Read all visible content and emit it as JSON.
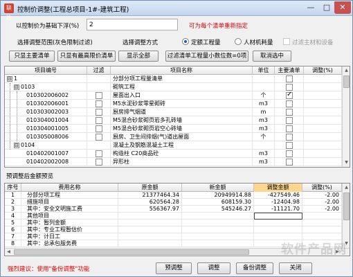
{
  "window": {
    "title": "控制价调整(工程总项目-1#-建筑工程)",
    "app_icon": "联达",
    "minimize_glyph": "—",
    "maximize_glyph": "□",
    "close_glyph": "✕"
  },
  "controls": {
    "base_label": "以控制价为基础下浮(%)",
    "base_value": "2",
    "base_note": "可为每个清单重新指定",
    "scope_label": "选择调整范围(灰色限制过滤)",
    "method_label": "选择调整方式",
    "radio_quota": "定额工程量",
    "radio_resource": "人材机耗量",
    "filter_main": "过滤主材和设备",
    "btn_main_only": "只显主要清单",
    "btn_limited": "只显有最高限价清单",
    "btn_show_all": "显示全部",
    "btn_filter_decimal": "过滤清单工程量小数位数=0项",
    "btn_cancel_select": "取消选中"
  },
  "top_grid": {
    "headers": [
      "项目编号",
      "过滤",
      "项目名称",
      "单位",
      "主要清单",
      "调整(%)"
    ],
    "rows": [
      {
        "code": "1",
        "name": "分部分项工程量清单",
        "unit": "",
        "main": false,
        "level": 0,
        "expander": "⊟"
      },
      {
        "code": "0103",
        "name": "砌筑工程",
        "unit": "",
        "main": false,
        "level": 1,
        "expander": "⊟"
      },
      {
        "code": "010302006002",
        "name": "屋面出入口",
        "unit": "个",
        "main": true,
        "level": 2,
        "expander": ""
      },
      {
        "code": "010302006001",
        "name": "M5水泥砂浆零星砌砖",
        "unit": "m3",
        "main": false,
        "level": 2,
        "expander": ""
      },
      {
        "code": "010303002003",
        "name": "厨房排气烟道",
        "unit": "m",
        "main": false,
        "level": 2,
        "expander": ""
      },
      {
        "code": "010304001004",
        "name": "M5混合砂浆砌页岩多孔砖墙",
        "unit": "m3",
        "main": false,
        "level": 2,
        "expander": ""
      },
      {
        "code": "010304001005",
        "name": "M5混合砂浆砌页岩空心砖墙",
        "unit": "m3",
        "main": false,
        "level": 2,
        "expander": ""
      },
      {
        "code": "010305008006",
        "name": "厨房、卫生间排烟(气)道出屋面",
        "unit": "个",
        "main": false,
        "level": 2,
        "expander": ""
      },
      {
        "code": "0104",
        "name": "混凝土及钢筋混凝土工程",
        "unit": "",
        "main": false,
        "level": 1,
        "expander": "⊟"
      },
      {
        "code": "010402001007",
        "name": "构造柱 C20商品砼",
        "unit": "m3",
        "main": false,
        "level": 2,
        "expander": ""
      },
      {
        "code": "010402002008",
        "name": "异形柱",
        "unit": "m3",
        "main": false,
        "level": 2,
        "expander": ""
      }
    ]
  },
  "bottom_section": {
    "title": "预调整后金额预览",
    "headers": [
      "序号",
      "费用名称",
      "原金额",
      "新金额",
      "调整金额",
      "调整(%)"
    ],
    "rows": [
      {
        "no": "1",
        "name": "分部分项工程",
        "orig": "21377464.34",
        "new": "20949914.88",
        "adj": "-427549.46",
        "pct": "-2.00"
      },
      {
        "no": "2",
        "name": "措施项目",
        "orig": "620564.28",
        "new": "608159.30",
        "adj": "-12404.98",
        "pct": "-2.00"
      },
      {
        "no": "3",
        "name": "其中：安全文明施工费",
        "orig": "556367.97",
        "new": "545246.27",
        "adj": "-11121.70",
        "pct": "-2.00"
      },
      {
        "no": "4",
        "name": "其他项目",
        "orig": "",
        "new": "",
        "adj": "",
        "pct": ""
      },
      {
        "no": "5",
        "name": "其中：暂列金额",
        "orig": "",
        "new": "",
        "adj": "",
        "pct": ""
      },
      {
        "no": "6",
        "name": "其中：专业工程暂估价",
        "orig": "",
        "new": "",
        "adj": "",
        "pct": ""
      },
      {
        "no": "7",
        "name": "其中：计日工",
        "orig": "",
        "new": "",
        "adj": "",
        "pct": ""
      },
      {
        "no": "8",
        "name": "其中：总承包服务费",
        "orig": "",
        "new": "",
        "adj": "",
        "pct": ""
      }
    ]
  },
  "footer": {
    "hint": "强烈建议：使用\"备份调整\"功能",
    "btn_preview": "预调整",
    "btn_adjust": "调整",
    "btn_backup": "备份调整",
    "btn_close": "关闭"
  },
  "watermark": "软件产品网",
  "colors": {
    "red_note": "#e00000",
    "highlight_header": "#ffd690",
    "close_button": "#c75050"
  },
  "icons": {
    "expand": "⊟",
    "scroll_up": "▲",
    "scroll_down": "▼",
    "scroll_left": "◀",
    "scroll_right": "▶",
    "check": "✓"
  }
}
